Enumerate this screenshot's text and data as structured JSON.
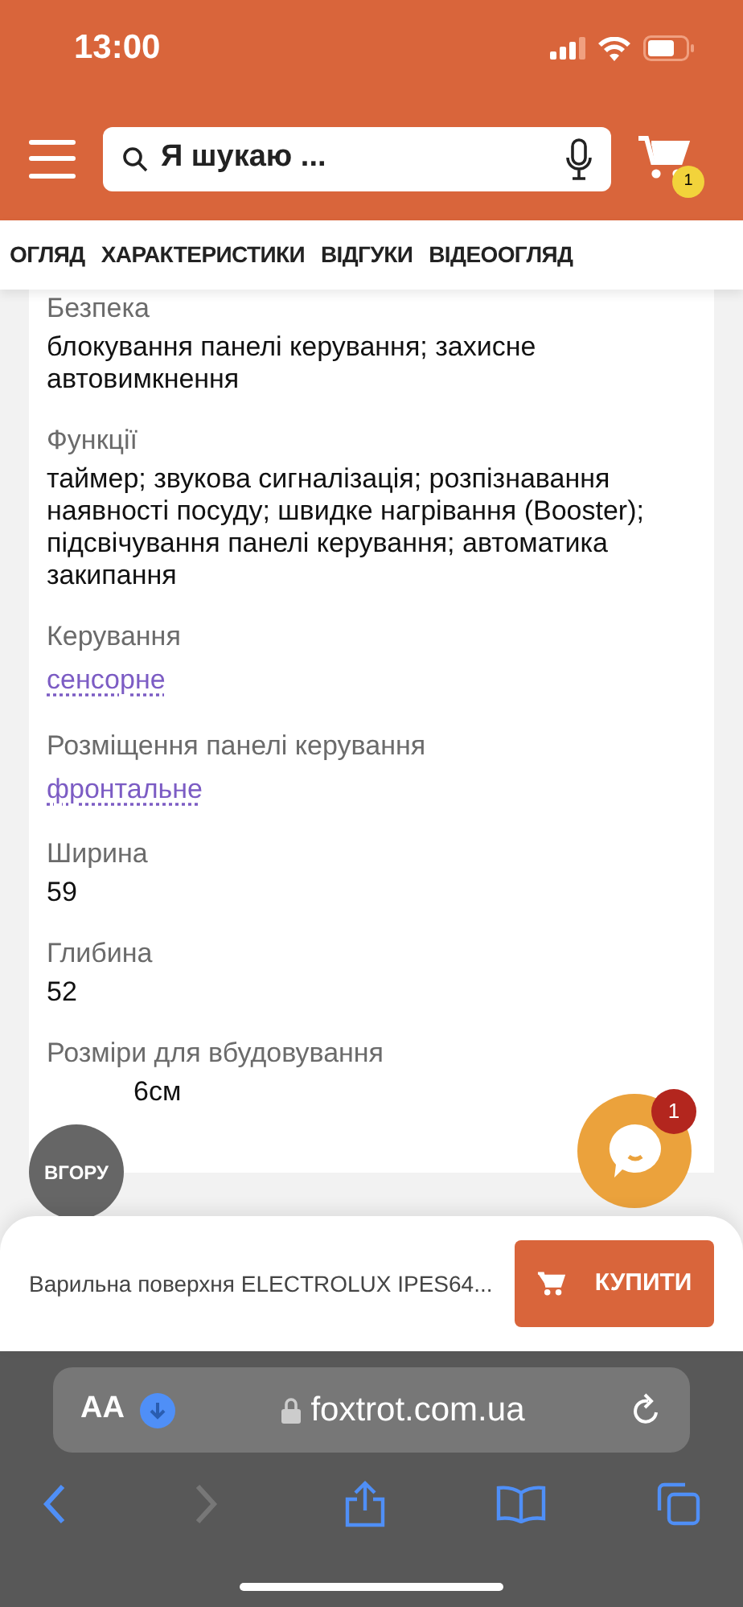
{
  "status_bar": {
    "time": "13:00"
  },
  "header": {
    "search": {
      "placeholder": "Я шукаю ..."
    },
    "cart_count": "1"
  },
  "tabs": [
    {
      "label": "ОГЛЯД"
    },
    {
      "label": "ХАРАКТЕРИСТИКИ"
    },
    {
      "label": "ВІДГУКИ"
    },
    {
      "label": "ВІДЕООГЛЯД"
    }
  ],
  "specs": [
    {
      "label": "Безпека",
      "value": "блокування панелі керування; захисне автовимкнення",
      "kind": "text"
    },
    {
      "label": "Функції",
      "value": "таймер; звукова сигналізація; розпізнавання наявності посуду; швидке нагрівання (Booster); підсвічування панелі керування; автоматика закипання",
      "kind": "text"
    },
    {
      "label": "Керування",
      "value": "сенсорне",
      "kind": "link"
    },
    {
      "label": "Розміщення панелі керування",
      "value": "фронтальне",
      "kind": "link"
    },
    {
      "label": "Ширина",
      "value": "59",
      "kind": "text"
    },
    {
      "label": "Глибина",
      "value": "52",
      "kind": "text"
    },
    {
      "label": "Розміри для вбудовування",
      "value": "6см",
      "kind": "text"
    }
  ],
  "scroll_top_button": {
    "label": "ВГОРУ"
  },
  "chat_button": {
    "badge": "1"
  },
  "buy_bar": {
    "product": "Варильна поверхня ELECTROLUX IPES64...",
    "button": "КУПИТИ"
  },
  "browser": {
    "text_size": "AA",
    "url": "foxtrot.com.ua"
  }
}
